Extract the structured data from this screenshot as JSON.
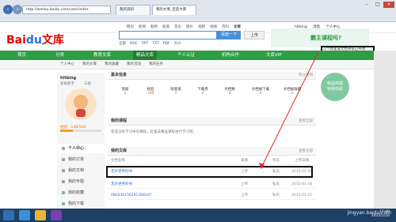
{
  "browser": {
    "address": "http://wenku.baidu.com/user/index",
    "tab_active": "我的文库_百度文库",
    "tab_other": "我的资料"
  },
  "topstrip": {
    "items": [
      "网页",
      "新闻",
      "贴吧",
      "知道",
      "音乐",
      "图片",
      "视频",
      "地图",
      "百科",
      "文库"
    ],
    "user": "hitbing",
    "msg": "消息",
    "center": "个人中心"
  },
  "header": {
    "logo_left": "Bai",
    "logo_mid": "du",
    "logo_right": "文库",
    "search_button": "百度一下",
    "upload_button": "上传",
    "filetypes": [
      "全部",
      "DOC",
      "PPT",
      "TXT",
      "PDF",
      "XLS"
    ],
    "banner_text": "霸主课程吗?"
  },
  "notification": "1个财富值文档审核已失败",
  "nav": [
    "首页",
    "分类",
    "教育文库",
    "精品文库",
    "个人认证",
    "机构合作",
    "文库VIP"
  ],
  "subnav": [
    "个人中心",
    "我的文库",
    "我的收藏",
    "我的活动",
    "我的任务"
  ],
  "profile": {
    "username": "hitbing",
    "level_label": "初级新手",
    "level": "三级",
    "progress_text": "经验：148/500"
  },
  "sidebar": [
    "个人中心",
    "我的订单",
    "我的文档",
    "我的专题",
    "我的收藏",
    "我的下载"
  ],
  "basic_info": {
    "title": "基本信息",
    "right": "积分说明",
    "stats": [
      {
        "label": "等级",
        "value": "2"
      },
      {
        "label": "经验",
        "value": "148"
      },
      {
        "label": "财富值",
        "value": "0"
      },
      {
        "label": "下载券",
        "value": "0"
      },
      {
        "label": "文档数",
        "value": "8"
      },
      {
        "label": "文档被下载",
        "value": "0"
      },
      {
        "label": "文档被收藏",
        "value": "0"
      }
    ]
  },
  "courses": {
    "title": "我的课程",
    "right": "查看全部",
    "empty": "您还没有学习中的课程，赶紧去精品课程进行学习吧。"
  },
  "docs": {
    "title": "我的文库",
    "right": "查看全部",
    "headers": [
      "文档名称",
      "来源",
      "状态",
      "上传日期"
    ],
    "rows": [
      {
        "name": "无声世界的书",
        "source": "上传",
        "status": "私有",
        "date": "2015-01-16"
      },
      {
        "name": "无声世界的书",
        "source": "上传",
        "status": "私有",
        "date": "2015-01-16"
      },
      {
        "name": "PBS030156291308107",
        "source": "上传",
        "status": "私有",
        "date": "2015-01-15"
      }
    ]
  },
  "right_tag": {
    "line1": "新提供期",
    "line2": "特惠体验"
  },
  "taskbar": {
    "time": "17:49",
    "date": "2015/1/16"
  },
  "watermark": "jingyan.baidu.com",
  "colors": {
    "green": "#2e9e44",
    "blue": "#2b6edb",
    "red": "#e10602"
  }
}
